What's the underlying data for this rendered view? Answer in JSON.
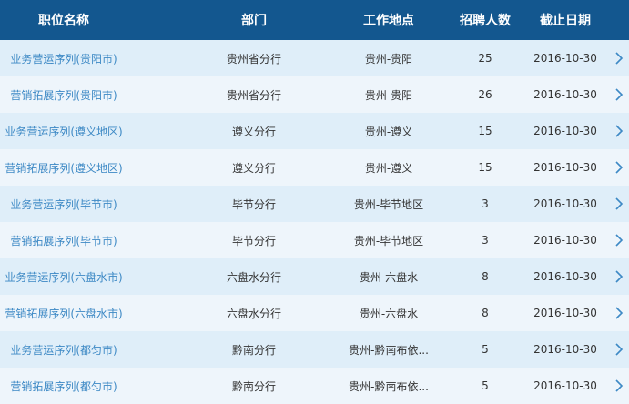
{
  "columns": {
    "title": "职位名称",
    "department": "部门",
    "location": "工作地点",
    "count": "招聘人数",
    "deadline": "截止日期"
  },
  "rows": [
    {
      "title": "业务营运序列(贵阳市)",
      "department": "贵州省分行",
      "location": "贵州-贵阳",
      "count": "25",
      "deadline": "2016-10-30"
    },
    {
      "title": "营销拓展序列(贵阳市)",
      "department": "贵州省分行",
      "location": "贵州-贵阳",
      "count": "26",
      "deadline": "2016-10-30"
    },
    {
      "title": "业务营运序列(遵义地区)",
      "department": "遵义分行",
      "location": "贵州-遵义",
      "count": "15",
      "deadline": "2016-10-30"
    },
    {
      "title": "营销拓展序列(遵义地区)",
      "department": "遵义分行",
      "location": "贵州-遵义",
      "count": "15",
      "deadline": "2016-10-30"
    },
    {
      "title": "业务营运序列(毕节市)",
      "department": "毕节分行",
      "location": "贵州-毕节地区",
      "count": "3",
      "deadline": "2016-10-30"
    },
    {
      "title": "营销拓展序列(毕节市)",
      "department": "毕节分行",
      "location": "贵州-毕节地区",
      "count": "3",
      "deadline": "2016-10-30"
    },
    {
      "title": "业务营运序列(六盘水市)",
      "department": "六盘水分行",
      "location": "贵州-六盘水",
      "count": "8",
      "deadline": "2016-10-30"
    },
    {
      "title": "营销拓展序列(六盘水市)",
      "department": "六盘水分行",
      "location": "贵州-六盘水",
      "count": "8",
      "deadline": "2016-10-30"
    },
    {
      "title": "业务营运序列(都匀市)",
      "department": "黔南分行",
      "location": "贵州-黔南布依...",
      "count": "5",
      "deadline": "2016-10-30"
    },
    {
      "title": "营销拓展序列(都匀市)",
      "department": "黔南分行",
      "location": "贵州-黔南布依...",
      "count": "5",
      "deadline": "2016-10-30"
    }
  ],
  "icons": {
    "row_arrow": "chevron-right-icon"
  },
  "colors": {
    "header_bg": "#13578f",
    "title_link": "#3d89c5",
    "row_odd": "#dfeef9",
    "row_even": "#eef5fb"
  }
}
